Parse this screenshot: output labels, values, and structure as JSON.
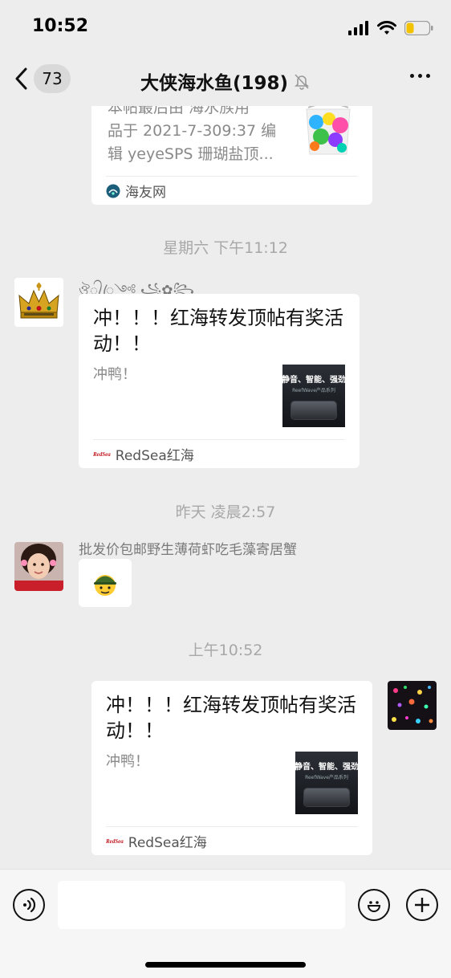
{
  "status": {
    "time": "10:52"
  },
  "nav": {
    "back_count": "73",
    "title": "大侠海水鱼(198)"
  },
  "messages": {
    "top_card": {
      "desc_lines": [
        "本帖最后由 海水族用",
        "品于 2021-7-309:37 编",
        "辑 yeyeSPS 珊瑚盐顶..."
      ],
      "source": "海友网"
    },
    "time1": "星期六 下午11:12",
    "msg1": {
      "sender": "ঔৣ᭄ꦿ༺ ꧁✿꧂",
      "title": "冲！！！红海转发顶帖有奖活动！！",
      "desc": "冲鸭！",
      "thumb_text": "静音、智能、强劲",
      "thumb_sub": "ReefWave产品系列",
      "source": "RedSea红海",
      "source_logo": "RedSea"
    },
    "time2": "昨天 凌晨2:57",
    "msg2": {
      "sender": "批发价包邮野生薄荷虾吃毛藻寄居蟹",
      "sticker": "soldier-emoji"
    },
    "time3": "上午10:52",
    "msg3": {
      "title": "冲！！！红海转发顶帖有奖活动！！",
      "desc": "冲鸭！",
      "thumb_text": "静音、智能、强劲",
      "thumb_sub": "ReefWave产品系列",
      "source": "RedSea红海",
      "source_logo": "RedSea"
    }
  },
  "input": {
    "voice_icon": "voice-icon",
    "emoji_icon": "emoji-icon",
    "plus_icon": "plus-icon"
  }
}
